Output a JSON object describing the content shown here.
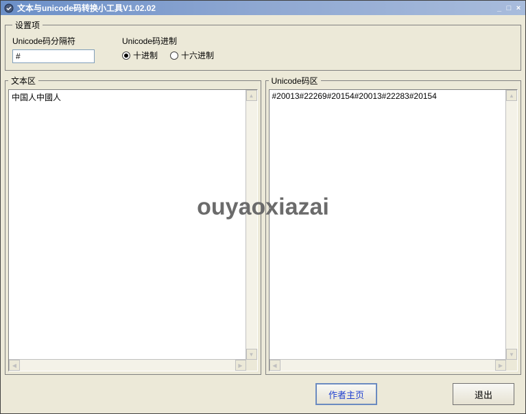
{
  "window": {
    "title": "文本与unicode码转换小工具V1.02.02"
  },
  "settings": {
    "legend": "设置项",
    "separator": {
      "label": "Unicode码分隔符",
      "value": "#"
    },
    "radix": {
      "label": "Unicode码进制",
      "decimal_label": "十进制",
      "hex_label": "十六进制",
      "selected": "decimal"
    }
  },
  "panes": {
    "text": {
      "legend": "文本区",
      "value": "中国人中國人"
    },
    "unicode": {
      "legend": "Unicode码区",
      "value": "#20013#22269#20154#20013#22283#20154"
    }
  },
  "footer": {
    "homepage_label": "作者主页",
    "exit_label": "退出"
  },
  "watermark": "ouyaoxiazai"
}
